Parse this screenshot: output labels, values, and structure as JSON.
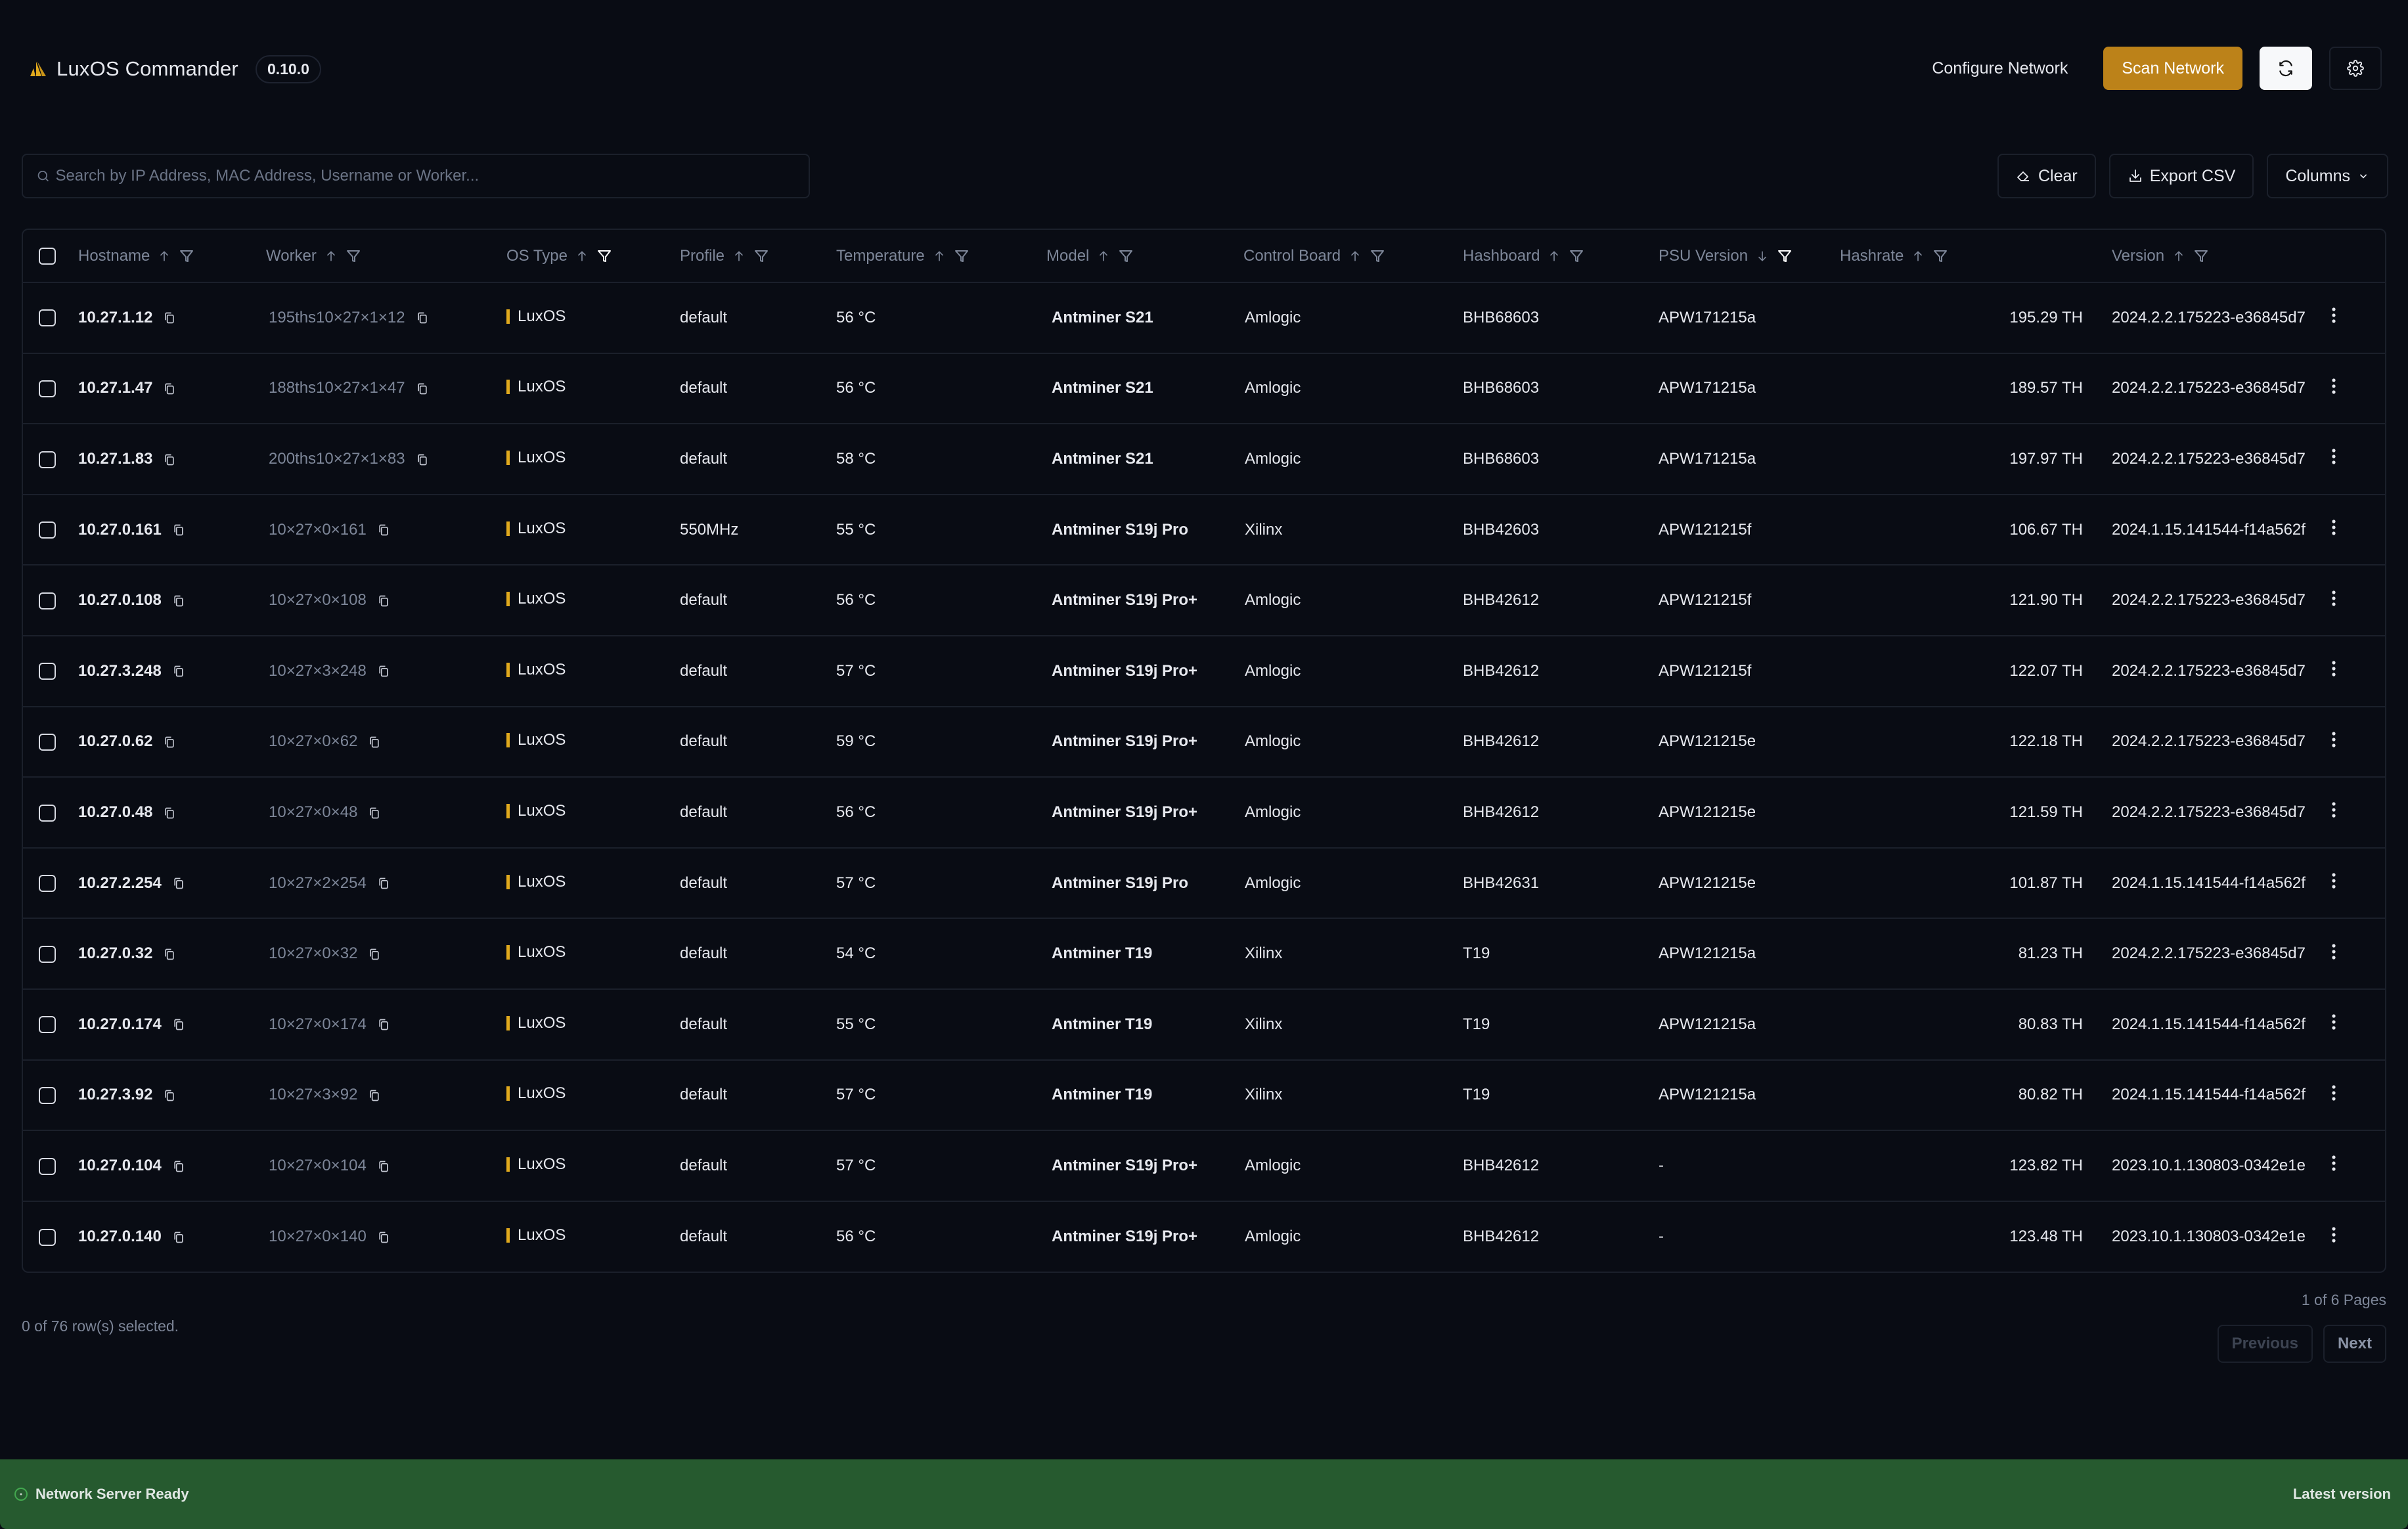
{
  "app": {
    "title": "LuxOS Commander",
    "version": "0.10.0",
    "brand_color": "#e1aa1d"
  },
  "header": {
    "configure_network_label": "Configure Network",
    "scan_network_label": "Scan Network",
    "refresh_icon": "refresh-icon",
    "settings_icon": "gear-icon",
    "accent_color": "#bc8219"
  },
  "toolbar": {
    "search_placeholder": "Search by IP Address, MAC Address, Username or Worker...",
    "search_value": "",
    "clear_label": "Clear",
    "export_label": "Export CSV",
    "columns_label": "Columns"
  },
  "table": {
    "columns": [
      {
        "label": "Hostname",
        "sort": "asc",
        "filter_active": false
      },
      {
        "label": "Worker",
        "sort": "asc",
        "filter_active": false
      },
      {
        "label": "OS Type",
        "sort": "asc",
        "filter_active": true
      },
      {
        "label": "Profile",
        "sort": "asc",
        "filter_active": false
      },
      {
        "label": "Temperature",
        "sort": "asc",
        "filter_active": false
      },
      {
        "label": "Model",
        "sort": "asc",
        "filter_active": false
      },
      {
        "label": "Control Board",
        "sort": "asc",
        "filter_active": false
      },
      {
        "label": "Hashboard",
        "sort": "asc",
        "filter_active": false
      },
      {
        "label": "PSU Version",
        "sort": "desc",
        "filter_active": true
      },
      {
        "label": "Hashrate",
        "sort": "asc",
        "filter_active": false
      },
      {
        "label": "Version",
        "sort": "asc",
        "filter_active": false
      }
    ],
    "rows": [
      {
        "hostname": "10.27.1.12",
        "worker": "195ths10×27×1×12",
        "os": "LuxOS",
        "profile": "default",
        "temperature": "56 °C",
        "model": "Antminer S21",
        "control_board": "Amlogic",
        "hashboard": "BHB68603",
        "psu": "APW171215a",
        "hashrate": "195.29 TH",
        "version": "2024.2.2.175223-e36845d7"
      },
      {
        "hostname": "10.27.1.47",
        "worker": "188ths10×27×1×47",
        "os": "LuxOS",
        "profile": "default",
        "temperature": "56 °C",
        "model": "Antminer S21",
        "control_board": "Amlogic",
        "hashboard": "BHB68603",
        "psu": "APW171215a",
        "hashrate": "189.57 TH",
        "version": "2024.2.2.175223-e36845d7"
      },
      {
        "hostname": "10.27.1.83",
        "worker": "200ths10×27×1×83",
        "os": "LuxOS",
        "profile": "default",
        "temperature": "58 °C",
        "model": "Antminer S21",
        "control_board": "Amlogic",
        "hashboard": "BHB68603",
        "psu": "APW171215a",
        "hashrate": "197.97 TH",
        "version": "2024.2.2.175223-e36845d7"
      },
      {
        "hostname": "10.27.0.161",
        "worker": "10×27×0×161",
        "os": "LuxOS",
        "profile": "550MHz",
        "temperature": "55 °C",
        "model": "Antminer S19j Pro",
        "control_board": "Xilinx",
        "hashboard": "BHB42603",
        "psu": "APW121215f",
        "hashrate": "106.67 TH",
        "version": "2024.1.15.141544-f14a562f"
      },
      {
        "hostname": "10.27.0.108",
        "worker": "10×27×0×108",
        "os": "LuxOS",
        "profile": "default",
        "temperature": "56 °C",
        "model": "Antminer S19j Pro+",
        "control_board": "Amlogic",
        "hashboard": "BHB42612",
        "psu": "APW121215f",
        "hashrate": "121.90 TH",
        "version": "2024.2.2.175223-e36845d7"
      },
      {
        "hostname": "10.27.3.248",
        "worker": "10×27×3×248",
        "os": "LuxOS",
        "profile": "default",
        "temperature": "57 °C",
        "model": "Antminer S19j Pro+",
        "control_board": "Amlogic",
        "hashboard": "BHB42612",
        "psu": "APW121215f",
        "hashrate": "122.07 TH",
        "version": "2024.2.2.175223-e36845d7"
      },
      {
        "hostname": "10.27.0.62",
        "worker": "10×27×0×62",
        "os": "LuxOS",
        "profile": "default",
        "temperature": "59 °C",
        "model": "Antminer S19j Pro+",
        "control_board": "Amlogic",
        "hashboard": "BHB42612",
        "psu": "APW121215e",
        "hashrate": "122.18 TH",
        "version": "2024.2.2.175223-e36845d7"
      },
      {
        "hostname": "10.27.0.48",
        "worker": "10×27×0×48",
        "os": "LuxOS",
        "profile": "default",
        "temperature": "56 °C",
        "model": "Antminer S19j Pro+",
        "control_board": "Amlogic",
        "hashboard": "BHB42612",
        "psu": "APW121215e",
        "hashrate": "121.59 TH",
        "version": "2024.2.2.175223-e36845d7"
      },
      {
        "hostname": "10.27.2.254",
        "worker": "10×27×2×254",
        "os": "LuxOS",
        "profile": "default",
        "temperature": "57 °C",
        "model": "Antminer S19j Pro",
        "control_board": "Amlogic",
        "hashboard": "BHB42631",
        "psu": "APW121215e",
        "hashrate": "101.87 TH",
        "version": "2024.1.15.141544-f14a562f"
      },
      {
        "hostname": "10.27.0.32",
        "worker": "10×27×0×32",
        "os": "LuxOS",
        "profile": "default",
        "temperature": "54 °C",
        "model": "Antminer T19",
        "control_board": "Xilinx",
        "hashboard": "T19",
        "psu": "APW121215a",
        "hashrate": "81.23 TH",
        "version": "2024.2.2.175223-e36845d7"
      },
      {
        "hostname": "10.27.0.174",
        "worker": "10×27×0×174",
        "os": "LuxOS",
        "profile": "default",
        "temperature": "55 °C",
        "model": "Antminer T19",
        "control_board": "Xilinx",
        "hashboard": "T19",
        "psu": "APW121215a",
        "hashrate": "80.83 TH",
        "version": "2024.1.15.141544-f14a562f"
      },
      {
        "hostname": "10.27.3.92",
        "worker": "10×27×3×92",
        "os": "LuxOS",
        "profile": "default",
        "temperature": "57 °C",
        "model": "Antminer T19",
        "control_board": "Xilinx",
        "hashboard": "T19",
        "psu": "APW121215a",
        "hashrate": "80.82 TH",
        "version": "2024.1.15.141544-f14a562f"
      },
      {
        "hostname": "10.27.0.104",
        "worker": "10×27×0×104",
        "os": "LuxOS",
        "profile": "default",
        "temperature": "57 °C",
        "model": "Antminer S19j Pro+",
        "control_board": "Amlogic",
        "hashboard": "BHB42612",
        "psu": "-",
        "hashrate": "123.82 TH",
        "version": "2023.10.1.130803-0342e1e"
      },
      {
        "hostname": "10.27.0.140",
        "worker": "10×27×0×140",
        "os": "LuxOS",
        "profile": "default",
        "temperature": "56 °C",
        "model": "Antminer S19j Pro+",
        "control_board": "Amlogic",
        "hashboard": "BHB42612",
        "psu": "-",
        "hashrate": "123.48 TH",
        "version": "2023.10.1.130803-0342e1e"
      }
    ]
  },
  "footer": {
    "rows_selected": "0 of 76 row(s) selected.",
    "page_info": "1 of 6 Pages",
    "previous_label": "Previous",
    "next_label": "Next"
  },
  "statusbar": {
    "status_text": "Network Server Ready",
    "version_text": "Latest version",
    "color": "#265a2f"
  }
}
